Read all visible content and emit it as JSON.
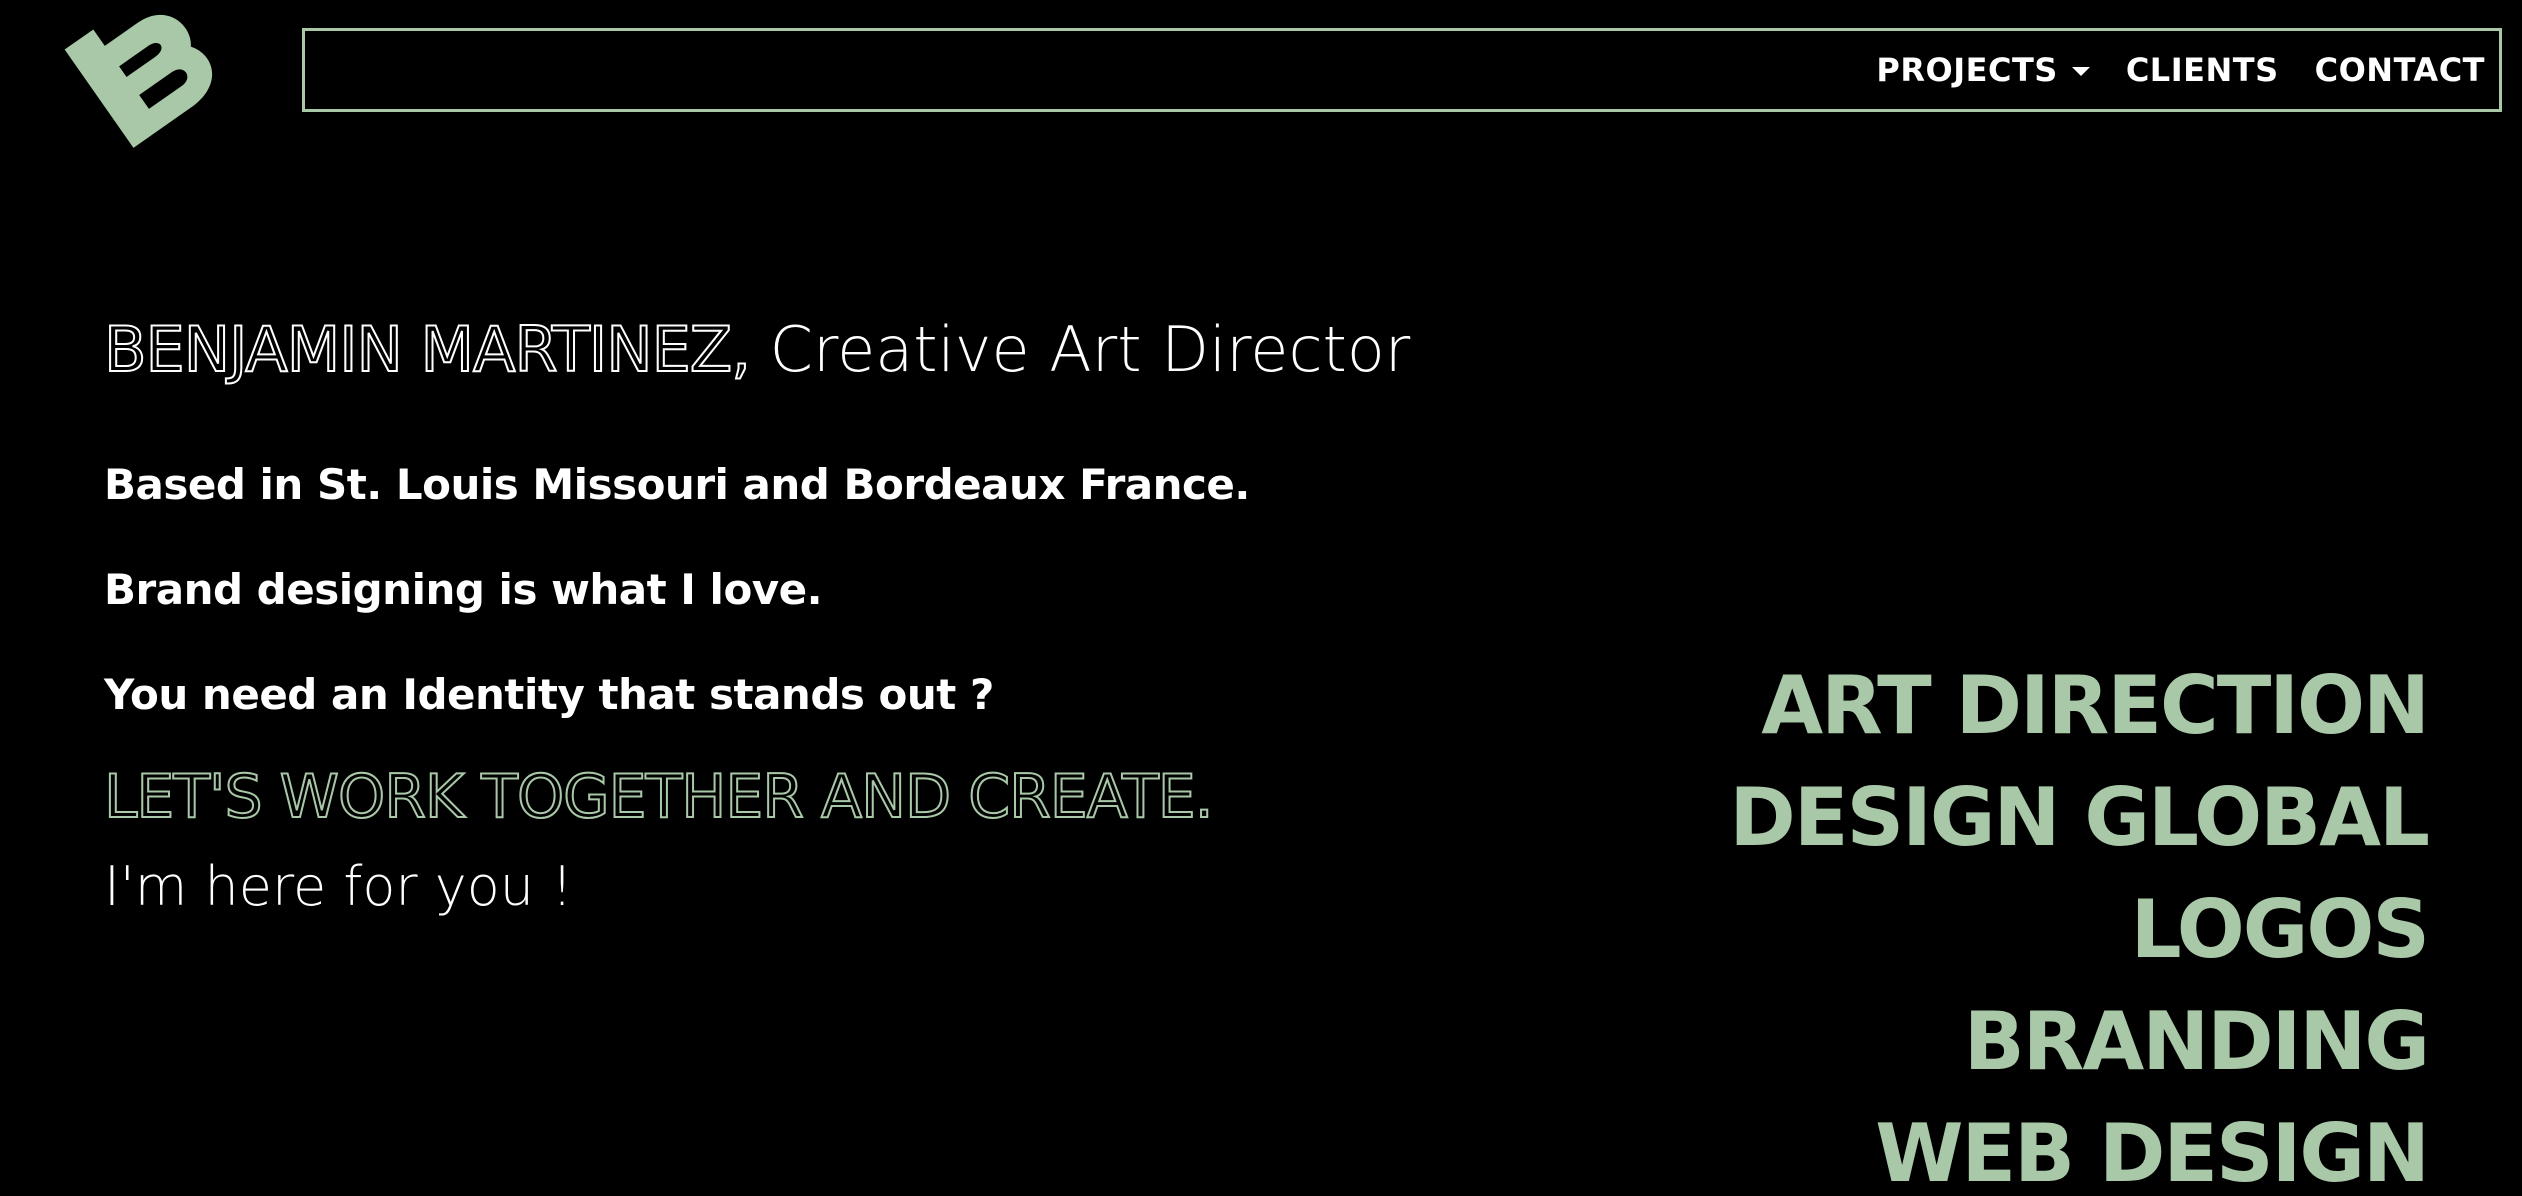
{
  "colors": {
    "background": "#000000",
    "accent": "#a8c8a8",
    "text": "#ffffff"
  },
  "logo": {
    "icon": "brand-logo-icon"
  },
  "nav": {
    "items": [
      {
        "label": "PROJECTS",
        "has_dropdown": true
      },
      {
        "label": "CLIENTS",
        "has_dropdown": false
      },
      {
        "label": "CONTACT",
        "has_dropdown": false
      }
    ]
  },
  "headline": {
    "name": "BENJAMIN MARTINEZ,",
    "role": "Creative Art Director"
  },
  "intro": {
    "line1": "Based in St. Louis Missouri and Bordeaux France.",
    "line2": "Brand designing is what I love.",
    "line3": "You need an Identity that stands out ?"
  },
  "cta": {
    "headline": "LET'S WORK TOGETHER AND CREATE.",
    "subline": "I'm here for you !"
  },
  "services": [
    "ART DIRECTION",
    "DESIGN GLOBAL",
    "LOGOS",
    "BRANDING",
    "WEB DESIGN"
  ]
}
